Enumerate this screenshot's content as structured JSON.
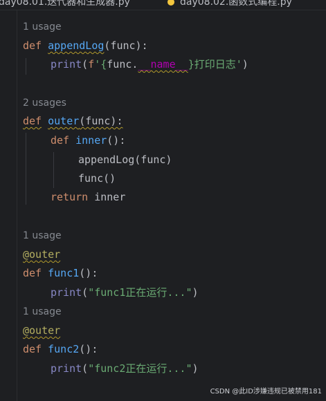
{
  "tabs": [
    {
      "label": "day08.01.迭代器和生成器.py"
    },
    {
      "label": "day08.02.函数式编程.py"
    }
  ],
  "colors": {
    "background": "#1e1f22",
    "keyword": "#cf8e6d",
    "function": "#56a8f5",
    "string": "#6aab73",
    "decorator": "#b3ae60",
    "dunder": "#b200b2",
    "hint": "#868a91"
  },
  "code": {
    "hint1": "1 usage",
    "l1": {
      "kw": "def",
      "name": "appendLog",
      "rest": "(func):"
    },
    "l2": {
      "builtin": "print",
      "p1": "(",
      "f": "f",
      "s1": "'{",
      "expr": "func.",
      "dunder": "__name__",
      "s2": "}打印日志'",
      "p2": ")"
    },
    "hint2": "2 usages",
    "l3": {
      "kw": "def",
      "name": "outer",
      "rest": "(func):"
    },
    "l4": {
      "kw": "def",
      "name": "inner",
      "rest": "():"
    },
    "l5": {
      "text": "appendLog(func)"
    },
    "l6": {
      "text": "func()"
    },
    "l7": {
      "kw": "return",
      "rest": " inner"
    },
    "hint3": "1 usage",
    "l8": {
      "deco": "@outer"
    },
    "l9": {
      "kw": "def",
      "name": "func1",
      "rest": "():"
    },
    "l10": {
      "builtin": "print",
      "p1": "(",
      "str": "\"func1正在运行...\"",
      "p2": ")"
    },
    "hint4": "1 usage",
    "l11": {
      "deco": "@outer"
    },
    "l12": {
      "kw": "def",
      "name": "func2",
      "rest": "():"
    },
    "l13": {
      "builtin": "print",
      "p1": "(",
      "str": "\"func2正在运行...\"",
      "p2": ")"
    }
  },
  "watermark": "CSDN @此ID涉嫌违规已被禁用181"
}
